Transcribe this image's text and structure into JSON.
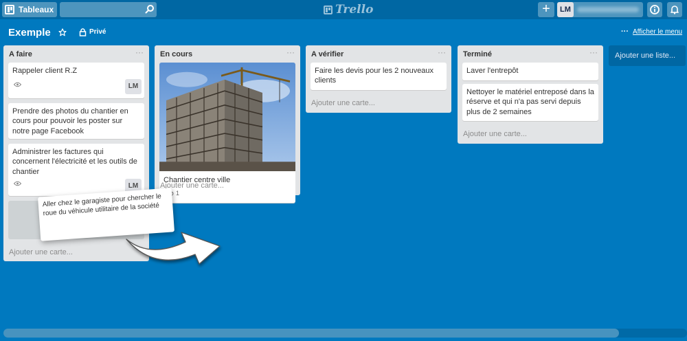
{
  "topbar": {
    "boards_label": "Tableaux",
    "search_placeholder": "",
    "logo_text": "Trello",
    "add_label": "+",
    "user_initials": "LM"
  },
  "board": {
    "title": "Exemple",
    "privacy": "Privé",
    "menu_link": "Afficher le menu",
    "menu_dots": "···"
  },
  "lists": [
    {
      "title": "A faire",
      "menu": "···",
      "cards": [
        {
          "text": "Rappeler client R.Z",
          "member": "LM"
        },
        {
          "text": "Prendre des photos du chantier en cours pour pouvoir les poster sur notre page Facebook"
        },
        {
          "text": "Administrer les factures qui concernent l'électricité et les outils de chantier",
          "member": "LM"
        }
      ],
      "add_card": "Ajouter une carte..."
    },
    {
      "title": "En cours",
      "menu": "···",
      "cards": [
        {
          "text": "Chantier centre ville",
          "attachments": "1"
        }
      ],
      "add_card": "Ajouter une carte..."
    },
    {
      "title": "A vérifier",
      "menu": "···",
      "cards": [
        {
          "text": "Faire les devis pour les 2 nouveaux clients"
        }
      ],
      "add_card": "Ajouter une carte..."
    },
    {
      "title": "Terminé",
      "menu": "···",
      "cards": [
        {
          "text": "Laver l'entrepôt"
        },
        {
          "text": "Nettoyer le matériel entreposé dans la réserve et qui n'a pas servi depuis plus de 2 semaines"
        }
      ],
      "add_card": "Ajouter une carte..."
    }
  ],
  "add_list": "Ajouter une liste...",
  "dragged_card": {
    "text": "Aller chez le garagiste pour chercher le roue du véhicule utilitaire de la société"
  },
  "colors": {
    "board_bg": "#0079bf",
    "header_bg": "#0067a3",
    "list_bg": "#e2e4e6",
    "card_bg": "#ffffff"
  }
}
